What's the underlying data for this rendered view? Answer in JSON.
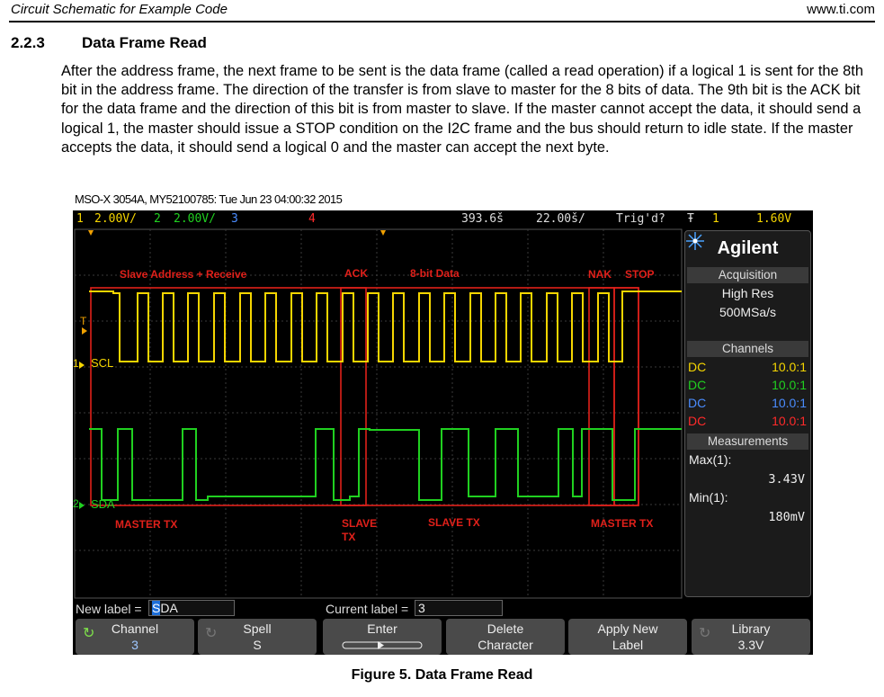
{
  "header": {
    "left": "Circuit Schematic for Example Code",
    "right": "www.ti.com"
  },
  "section": {
    "number": "2.2.3",
    "title": "Data Frame Read"
  },
  "paragraph": "After the address frame, the next frame to be sent is the data frame (called a read operation) if a logical 1 is sent for the 8th bit in the address frame. The direction of the transfer is from slave to master for the 8 bits of data. The 9th bit is the ACK bit for the data frame and the direction of this bit is from master to slave. If the master cannot accept the data, it should send a logical 1, the master should issue a STOP condition on the I2C frame and the bus should return to idle state. If the master accepts the data, it should send a logical 0 and the master can accept the next byte.",
  "scope": {
    "meta": "MSO-X 3054A, MY52100785: Tue Jun 23 04:00:32 2015",
    "topbar": {
      "ch1_num": "1",
      "ch1_scale": "2.00V/",
      "ch2_num": "2",
      "ch2_scale": "2.00V/",
      "ch3_num": "3",
      "ch4_num": "4",
      "time_pos": "393.6š",
      "time_scale": "22.00š/",
      "trig_status": "Trig'd?",
      "trig_icon": "Ŧ",
      "trig_ch": "1",
      "trig_level": "1.60V"
    },
    "sidebar": {
      "brand": "Agilent",
      "acq_header": "Acquisition",
      "acq_mode": "High Res",
      "acq_rate": "500MSa/s",
      "channels_header": "Channels",
      "channels": [
        {
          "coupling": "DC",
          "ratio": "10.0:1",
          "color": "#f5d500"
        },
        {
          "coupling": "DC",
          "ratio": "10.0:1",
          "color": "#20d020"
        },
        {
          "coupling": "DC",
          "ratio": "10.0:1",
          "color": "#4a8cff"
        },
        {
          "coupling": "DC",
          "ratio": "10.0:1",
          "color": "#ff2a2a"
        }
      ],
      "meas_header": "Measurements",
      "meas": [
        {
          "label": "Max(1):",
          "value": "3.43V"
        },
        {
          "label": "Min(1):",
          "value": "180mV"
        }
      ]
    },
    "traces": {
      "scl_label": "SCL",
      "sda_label": "SDA",
      "ch1_marker": "1",
      "ch2_marker": "2",
      "trig_marker": "T"
    },
    "annotations": {
      "slave_addr": "Slave Address + Receive",
      "ack": "ACK",
      "data": "8-bit Data",
      "nak": "NAK",
      "stop": "STOP",
      "master_tx_1": "MASTER TX",
      "slave_tx_short_l1": "SLAVE",
      "slave_tx_short_l2": "TX",
      "slave_tx": "SLAVE TX",
      "master_tx_2": "MASTER TX"
    },
    "label_row": {
      "new_label_text": "New label =",
      "new_label_value_cursor": "S",
      "new_label_value_rest": "DA",
      "current_label_text": "Current label =",
      "current_label_value": "3"
    },
    "softkeys": [
      {
        "l1": "Channel",
        "l2": "3"
      },
      {
        "l1": "Spell",
        "l2": "S"
      },
      {
        "l1": "Enter",
        "l2": ""
      },
      {
        "l1": "Delete",
        "l2": "Character"
      },
      {
        "l1": "Apply New",
        "l2": "Label"
      },
      {
        "l1": "Library",
        "l2": "3.3V"
      }
    ]
  },
  "caption": "Figure 5. Data Frame Read",
  "colors": {
    "scl": "#f5d500",
    "sda": "#20d020",
    "annotation": "#e0201a",
    "ch3": "#4a8cff",
    "ch4": "#ff2a2a"
  }
}
